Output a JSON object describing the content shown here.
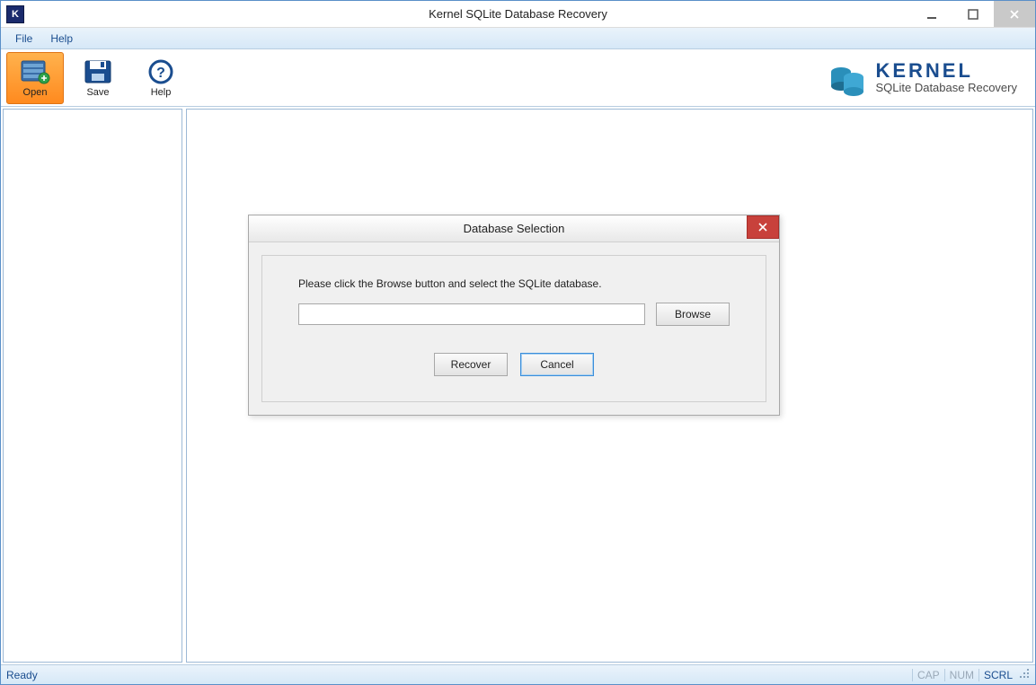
{
  "window": {
    "title": "Kernel SQLite Database Recovery",
    "app_icon_letter": "K"
  },
  "menu": {
    "file": "File",
    "help": "Help"
  },
  "toolbar": {
    "open": "Open",
    "save": "Save",
    "help": "Help"
  },
  "brand": {
    "name": "KERNEL",
    "sub": "SQLite Database Recovery"
  },
  "dialog": {
    "title": "Database Selection",
    "instruction": "Please click the Browse button and select the SQLite database.",
    "path_value": "",
    "browse": "Browse",
    "recover": "Recover",
    "cancel": "Cancel"
  },
  "status": {
    "ready": "Ready",
    "cap": "CAP",
    "num": "NUM",
    "scrl": "SCRL"
  }
}
